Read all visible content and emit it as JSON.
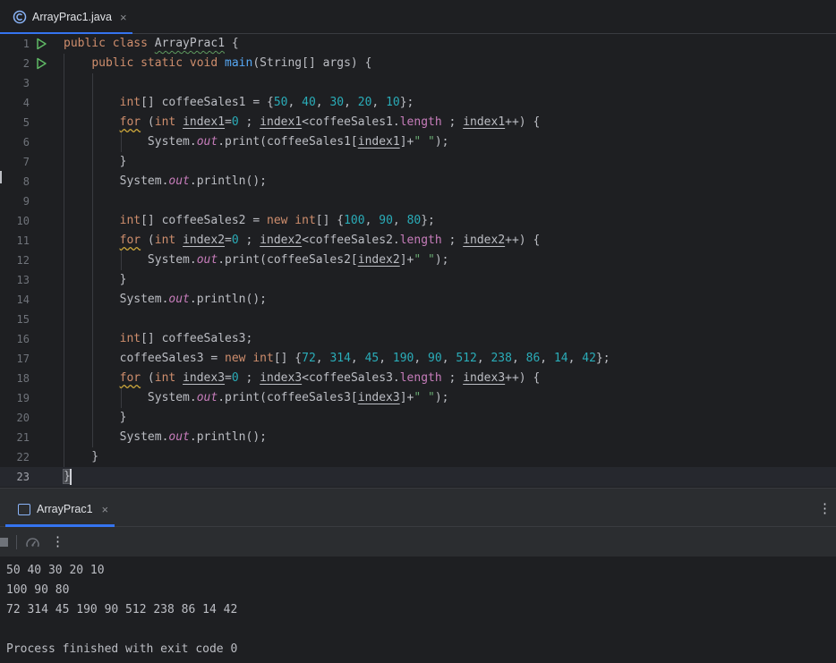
{
  "editor_tab": {
    "label": "ArrayPrac1.java",
    "close": "×",
    "icon": "java-class-icon"
  },
  "editor": {
    "line_numbers": [
      "1",
      "2",
      "3",
      "4",
      "5",
      "6",
      "7",
      "8",
      "9",
      "10",
      "11",
      "12",
      "13",
      "14",
      "15",
      "16",
      "17",
      "18",
      "19",
      "20",
      "21",
      "22",
      "23"
    ]
  },
  "run_window": {
    "tab_label": "ArrayPrac1",
    "tab_close": "×",
    "menu": "⋮",
    "toolbar_more": "⋮"
  },
  "console": {
    "lines": [
      "50 40 30 20 10",
      "100 90 80",
      "72 314 45 190 90 512 238 86 14 42",
      "",
      "Process finished with exit code 0"
    ]
  },
  "colors": {
    "accent": "#3574f0",
    "keyword": "#cf8e6d",
    "number": "#2aacb8",
    "string": "#6aab73",
    "method": "#56a8f5",
    "field": "#c77dbb",
    "run_gutter": "#5fb865"
  }
}
